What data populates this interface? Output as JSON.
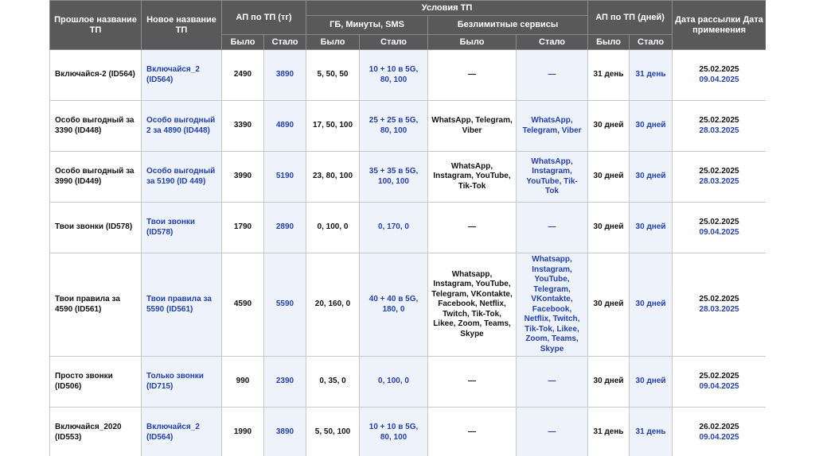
{
  "header": {
    "old_name": "Прошлое название ТП",
    "new_name": "Новое название ТП",
    "ap_tg": "АП по ТП (тг)",
    "conditions": "Условия ТП",
    "gb_min_sms": "ГБ, Минуты, SMS",
    "unlimited": "Безлимитные сервисы",
    "ap_days": "АП по ТП (дней)",
    "date": "Дата рассылки Дата применения",
    "was": "Было",
    "became": "Стало"
  },
  "rows": [
    {
      "old_name": "Включайся-2 (ID564)",
      "new_name": "Включайся_2 (ID564)",
      "ap_was": "2490",
      "ap_new": "3890",
      "gb_was": "5, 50, 50",
      "gb_new": "10 + 10 в 5G, 80, 100",
      "unl_was": "—",
      "unl_new": "—",
      "days_was": "31 день",
      "days_new": "31 день",
      "date_send": "25.02.2025",
      "date_apply": "09.04.2025"
    },
    {
      "old_name": "Особо выгодный за 3390 (ID448)",
      "new_name": "Особо выгодный 2 за 4890 (ID448)",
      "ap_was": "3390",
      "ap_new": "4890",
      "gb_was": "17, 50, 100",
      "gb_new": "25 + 25 в 5G, 80, 100",
      "unl_was": "WhatsApp, Telegram, Viber",
      "unl_new": "WhatsApp, Telegram, Viber",
      "days_was": "30 дней",
      "days_new": "30 дней",
      "date_send": "25.02.2025",
      "date_apply": "28.03.2025"
    },
    {
      "old_name": "Особо выгодный за 3990 (ID449)",
      "new_name": "Особо выгодный за 5190 (ID 449)",
      "ap_was": "3990",
      "ap_new": "5190",
      "gb_was": "23, 80, 100",
      "gb_new": "35 + 35 в 5G, 100, 100",
      "unl_was": "WhatsApp, Instagram, YouTube, Tik-Tok",
      "unl_new": "WhatsApp, Instagram, YouTube, Tik-Tok",
      "days_was": "30 дней",
      "days_new": "30 дней",
      "date_send": "25.02.2025",
      "date_apply": "28.03.2025"
    },
    {
      "old_name": "Твои звонки (ID578)",
      "new_name": "Твои звонки (ID578)",
      "ap_was": "1790",
      "ap_new": "2890",
      "gb_was": "0, 100, 0",
      "gb_new": "0, 170, 0",
      "unl_was": "—",
      "unl_new": "—",
      "days_was": "30 дней",
      "days_new": "30 дней",
      "date_send": "25.02.2025",
      "date_apply": "09.04.2025"
    },
    {
      "old_name": "Твои правила за 4590 (ID561)",
      "new_name": "Твои правила за 5590 (ID561)",
      "ap_was": "4590",
      "ap_new": "5590",
      "gb_was": "20, 160, 0",
      "gb_new": "40 + 40 в 5G, 180, 0",
      "unl_was": "Whatsapp, Instagram, YouTube, Telegram, VKontakte, Facebook, Netflix, Twitch, Tik-Tok, Likee, Zoom, Teams, Skype",
      "unl_new": "Whatsapp, Instagram, YouTube, Telegram, VKontakte, Facebook, Netflix, Twitch, Tik-Tok, Likee, Zoom, Teams, Skype",
      "days_was": "30 дней",
      "days_new": "30 дней",
      "date_send": "25.02.2025",
      "date_apply": "28.03.2025"
    },
    {
      "old_name": "Просто звонки (ID506)",
      "new_name": "Только звонки (ID715)",
      "ap_was": "990",
      "ap_new": "2390",
      "gb_was": "0, 35, 0",
      "gb_new": "0, 100, 0",
      "unl_was": "—",
      "unl_new": "—",
      "days_was": "30 дней",
      "days_new": "30 дней",
      "date_send": "25.02.2025",
      "date_apply": "09.04.2025"
    },
    {
      "old_name": "Включайся_2020 (ID553)",
      "new_name": "Включайся_2 (ID564)",
      "ap_was": "1990",
      "ap_new": "3890",
      "gb_was": "5, 50, 100",
      "gb_new": "10 + 10 в 5G, 80, 100",
      "unl_was": "—",
      "unl_new": "—",
      "days_was": "31 день",
      "days_new": "31 день",
      "date_send": "26.02.2025",
      "date_apply": "09.04.2025"
    }
  ]
}
